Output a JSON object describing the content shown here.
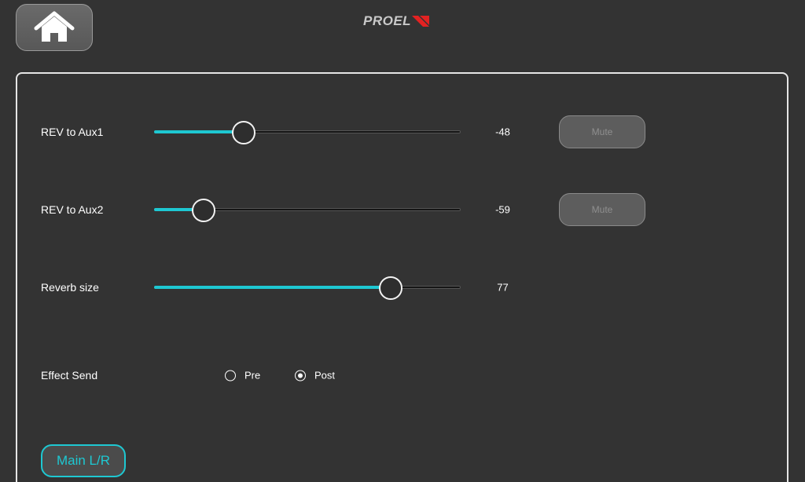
{
  "header": {
    "home_icon": "home-icon",
    "logo_text": "PROEL"
  },
  "colors": {
    "accent": "#1ec8d2",
    "logo_mark": "#e32222",
    "background": "#333333"
  },
  "controls": {
    "rev_aux1": {
      "label": "REV to Aux1",
      "value": "-48",
      "level": 0.29,
      "mute_label": "Mute"
    },
    "rev_aux2": {
      "label": "REV to Aux2",
      "value": "-59",
      "level": 0.16,
      "mute_label": "Mute"
    },
    "reverb_size": {
      "label": "Reverb size",
      "value": "77",
      "level": 0.77
    }
  },
  "effect_send": {
    "label": "Effect Send",
    "options": [
      {
        "label": "Pre",
        "checked": false
      },
      {
        "label": "Post",
        "checked": true
      }
    ]
  },
  "footer": {
    "main_lr_label": "Main L/R"
  }
}
